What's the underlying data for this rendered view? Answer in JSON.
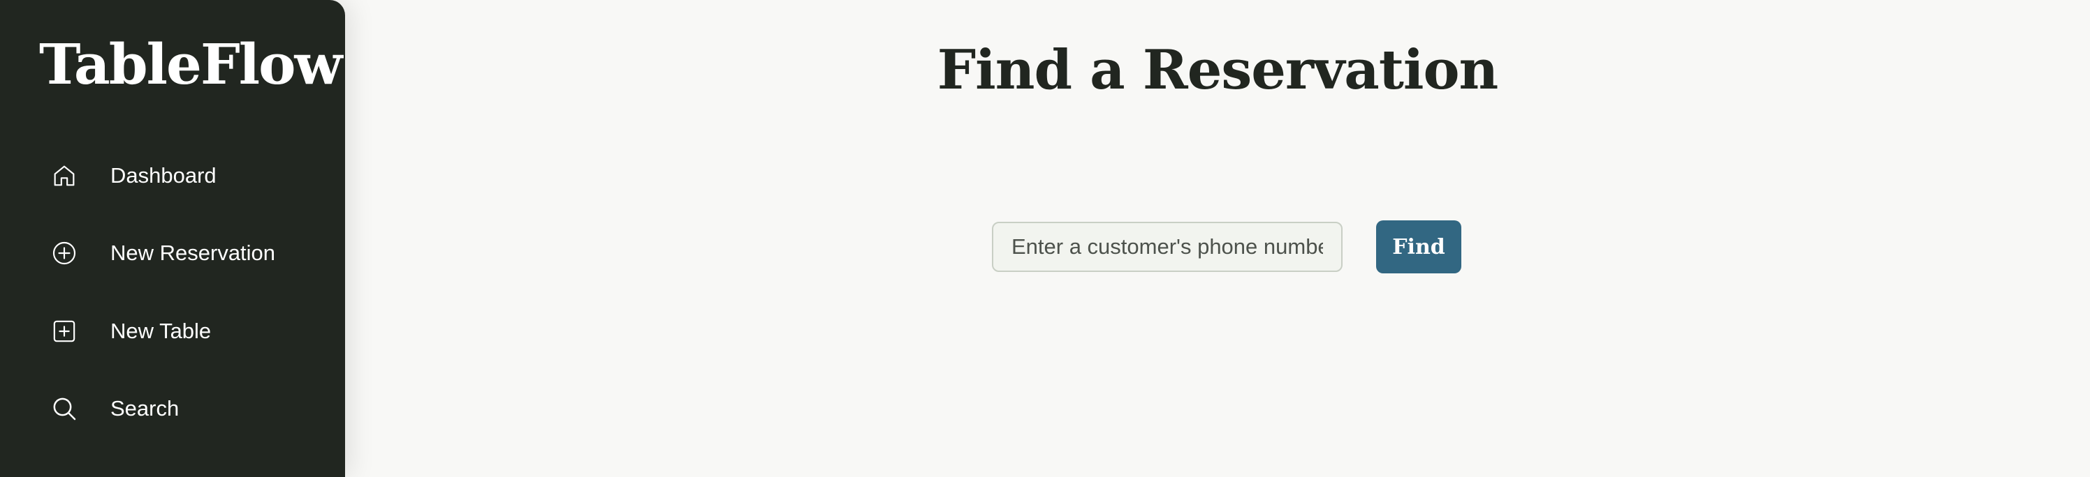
{
  "sidebar": {
    "brand": "TableFlow",
    "items": [
      {
        "label": "Dashboard",
        "icon": "home-icon"
      },
      {
        "label": "New Reservation",
        "icon": "plus-circle-icon"
      },
      {
        "label": "New Table",
        "icon": "plus-square-icon"
      },
      {
        "label": "Search",
        "icon": "search-icon"
      }
    ]
  },
  "main": {
    "title": "Find a Reservation",
    "search": {
      "placeholder": "Enter a customer's phone number",
      "value": "",
      "button_label": "Find"
    }
  },
  "colors": {
    "sidebar_bg": "#212620",
    "page_bg": "#f8f8f6",
    "accent": "#326782",
    "title_text": "#212620"
  }
}
